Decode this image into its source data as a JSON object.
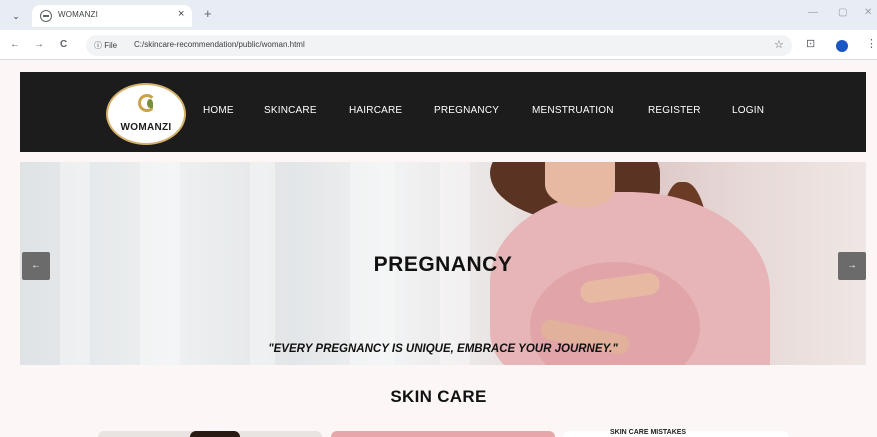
{
  "browser": {
    "tab_title": "WOMANZI",
    "tab_close": "×",
    "new_tab": "+",
    "tab_list_icon": "⌄",
    "minimize": "—",
    "maximize": "▢",
    "close": "✕",
    "back": "←",
    "forward": "→",
    "reload": "C",
    "file_badge": "ⓘ File",
    "url": "C:/skincare-recommendation/public/woman.html",
    "star": "☆",
    "extensions": "⊡",
    "menu": "⋮"
  },
  "site": {
    "logo_text": "WOMANZI",
    "nav": [
      "HOME",
      "SKINCARE",
      "HAIRCARE",
      "PREGNANCY",
      "MENSTRUATION",
      "REGISTER",
      "LOGIN"
    ]
  },
  "hero": {
    "title": "PREGNANCY",
    "quote": "\"EVERY PREGNANCY IS UNIQUE, EMBRACE YOUR JOURNEY.\"",
    "prev_label": "←",
    "next_label": "→"
  },
  "section": {
    "title": "SKIN CARE",
    "card3_peek": "SKIN CARE MISTAKES"
  },
  "colors": {
    "navbar": "#1c1c1c",
    "page_bg": "#fdf6f6",
    "accent_gold": "#c9a24a",
    "slider_button": "#6b6b6b"
  }
}
